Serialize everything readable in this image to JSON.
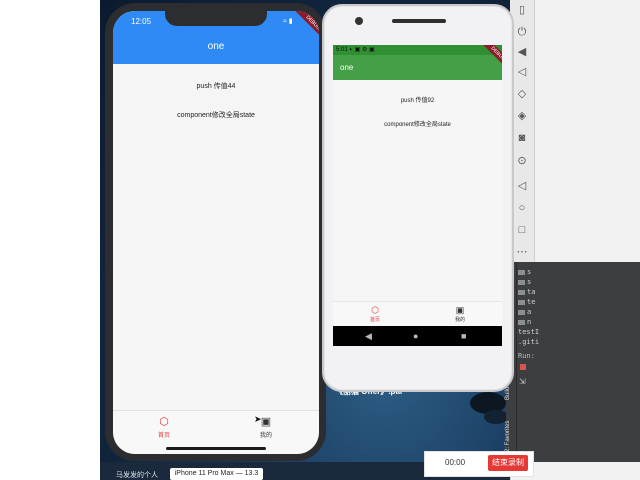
{
  "ios": {
    "time": "12:05",
    "status_icons": "≈ ▮",
    "debug_ribbon": "DEBUG",
    "title": "one",
    "text_push": "push 传值44",
    "text_component": "component修改全局state",
    "tabs": [
      {
        "label": "首页",
        "icon": "hexagon-icon",
        "active": true
      },
      {
        "label": "我的",
        "icon": "id-card-icon",
        "active": false
      }
    ],
    "colors": {
      "appbar": "#2f8af5",
      "active_tab": "#e53935"
    }
  },
  "android": {
    "status_text": "5:01 ◐ ▣ ⚙ ▣",
    "debug_ribbon": "DEBUG",
    "title": "one",
    "text_push": "push 传值92",
    "text_component": "component修改全局state",
    "tabs": [
      {
        "label": "首页",
        "icon": "hexagon-icon",
        "active": true
      },
      {
        "label": "我的",
        "icon": "id-card-icon",
        "active": false
      }
    ],
    "nav_icons": [
      "back-triangle-icon",
      "home-circle-icon",
      "recents-square-icon"
    ],
    "colors": {
      "appbar": "#43a047",
      "statusbar": "#2f8f32"
    }
  },
  "desktop": {
    "caption": "《丽猫 Offer》.par",
    "simulator_label": "iPhone 11 Pro Max — 13.3",
    "taskbar_text": "马发发的个人"
  },
  "ide": {
    "tree_items": [
      "s",
      "s",
      "ta",
      "te",
      "a",
      "n",
      "testI",
      ".giti"
    ],
    "run_label": "Run:",
    "side_labels": [
      "Build Vari",
      "2: Favorites"
    ]
  },
  "recorder": {
    "time": "00:00",
    "stop_label": "结束录制"
  }
}
